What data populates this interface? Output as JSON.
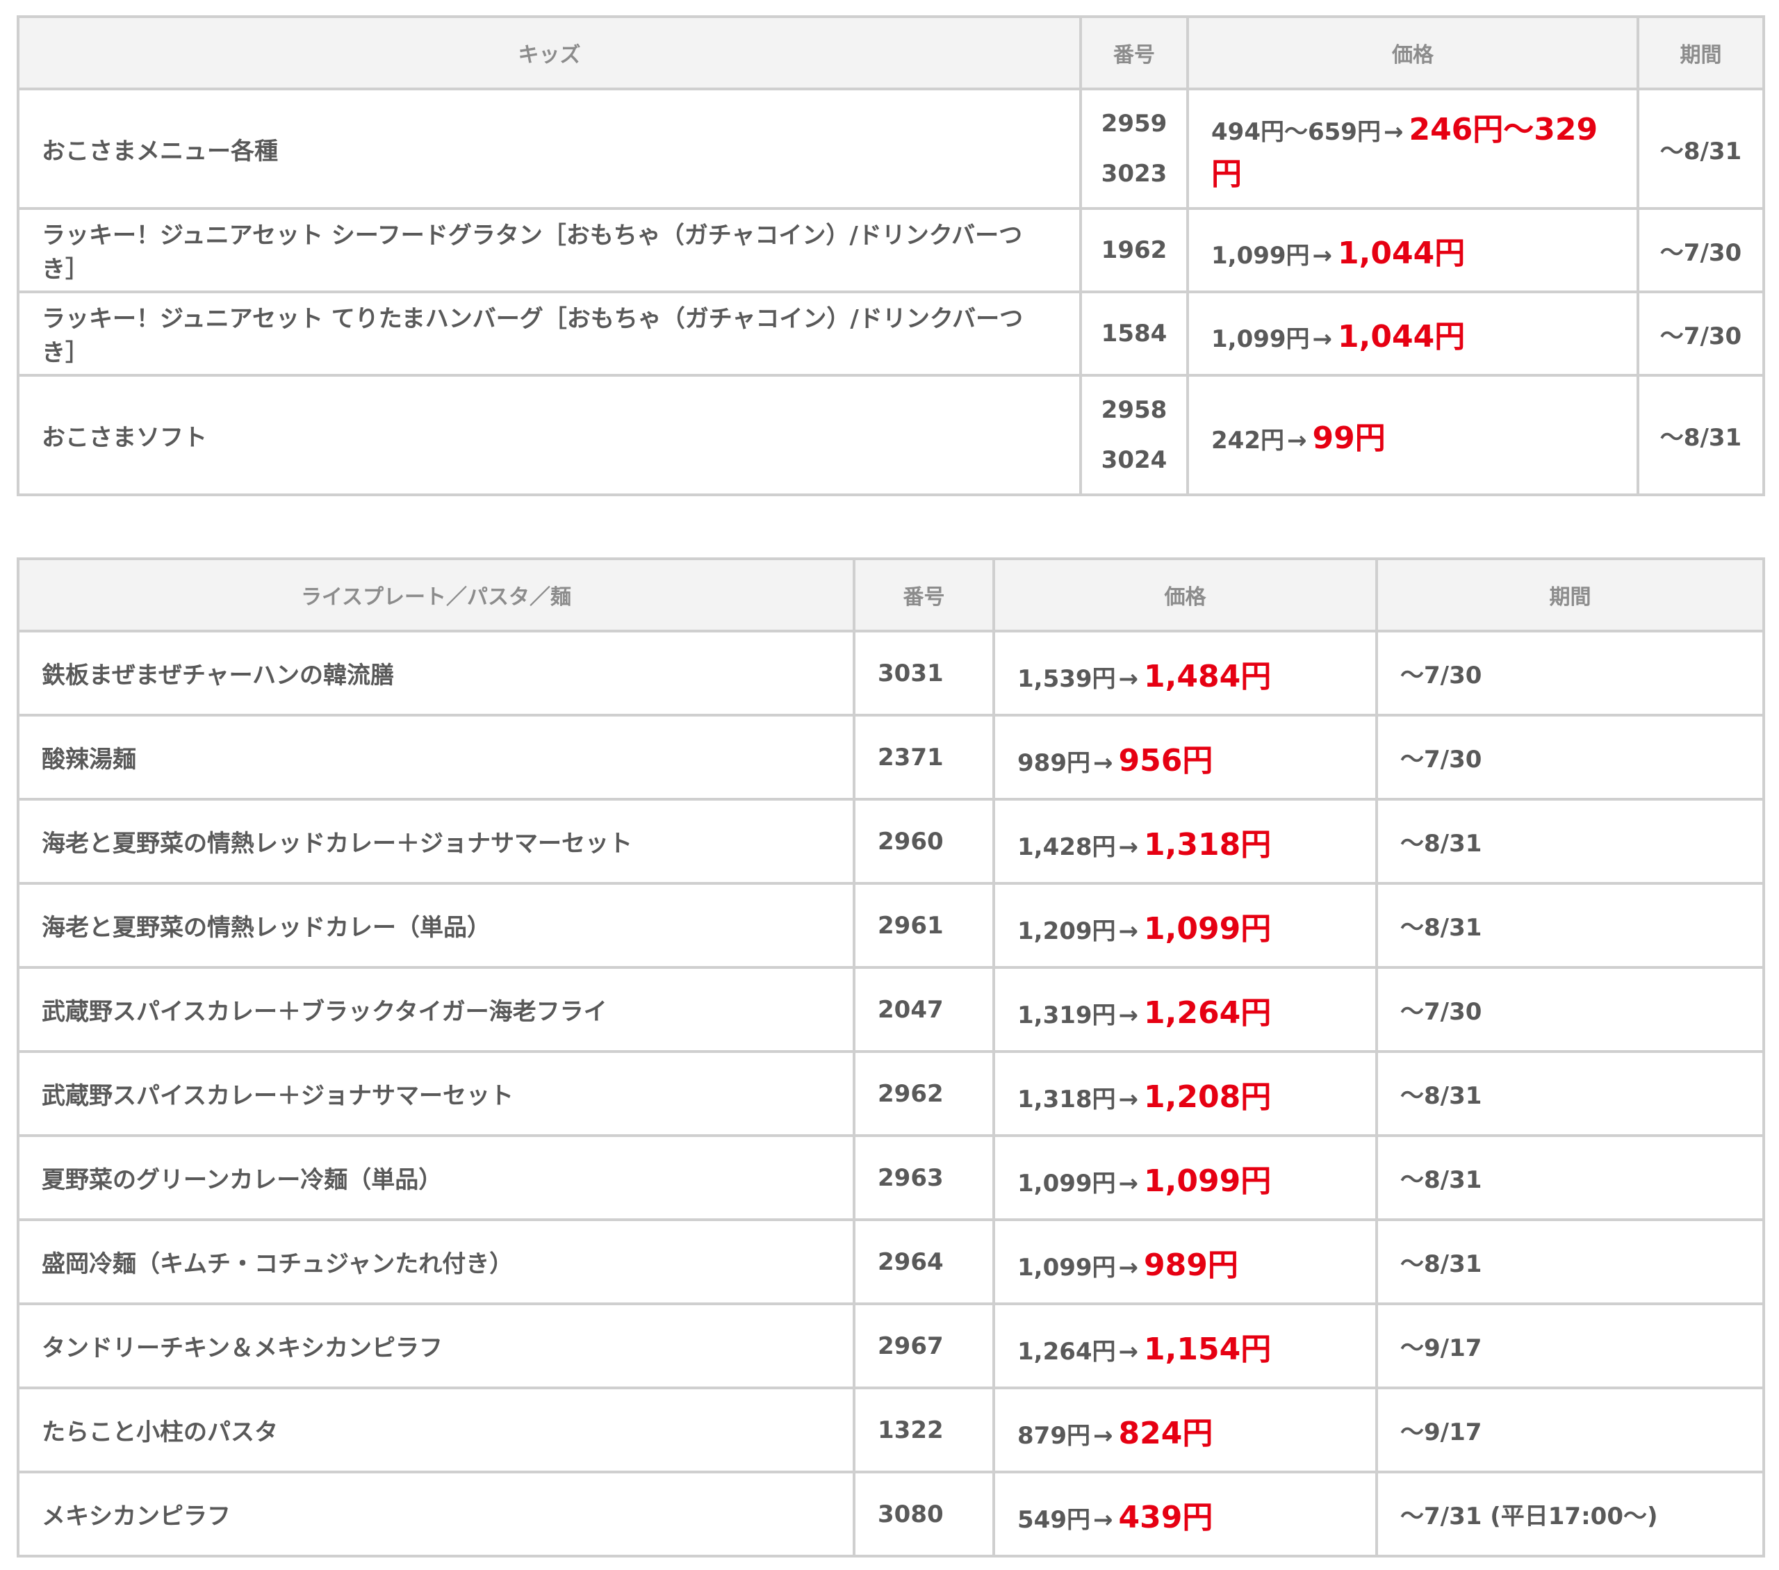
{
  "kids_table": {
    "headers": {
      "name": "キッズ",
      "number": "番号",
      "price": "価格",
      "period": "期間"
    },
    "rows": [
      {
        "name": "おこさまメニュー各種",
        "numbers": [
          "2959",
          "3023"
        ],
        "old_price": "494円～659円",
        "arrow": "→",
        "new_price": "246円～329円",
        "period": "～8/31"
      },
      {
        "name": "ラッキー！ジュニアセット シーフードグラタン［おもちゃ（ガチャコイン）/ドリンクバーつき］",
        "numbers": [
          "1962"
        ],
        "old_price": "1,099円",
        "arrow": "→",
        "new_price": "1,044円",
        "period": "～7/30"
      },
      {
        "name": "ラッキー！ジュニアセット てりたまハンバーグ［おもちゃ（ガチャコイン）/ドリンクバーつき］",
        "numbers": [
          "1584"
        ],
        "old_price": "1,099円",
        "arrow": "→",
        "new_price": "1,044円",
        "period": "～7/30"
      },
      {
        "name": "おこさまソフト",
        "numbers": [
          "2958",
          "3024"
        ],
        "old_price": "242円",
        "arrow": "→",
        "new_price": "99円",
        "period": "～8/31"
      }
    ]
  },
  "rice_table": {
    "headers": {
      "name": "ライスプレート／パスタ／麺",
      "number": "番号",
      "price": "価格",
      "period": "期間"
    },
    "rows": [
      {
        "name": "鉄板まぜまぜチャーハンの韓流膳",
        "numbers": [
          "3031"
        ],
        "old_price": "1,539円",
        "arrow": "→",
        "new_price": "1,484円",
        "period": "～7/30"
      },
      {
        "name": "酸辣湯麺",
        "numbers": [
          "2371"
        ],
        "old_price": "989円",
        "arrow": "→",
        "new_price": "956円",
        "period": "～7/30"
      },
      {
        "name": "海老と夏野菜の情熱レッドカレー＋ジョナサマーセット",
        "numbers": [
          "2960"
        ],
        "old_price": "1,428円",
        "arrow": "→",
        "new_price": "1,318円",
        "period": "～8/31"
      },
      {
        "name": "海老と夏野菜の情熱レッドカレー（単品）",
        "numbers": [
          "2961"
        ],
        "old_price": "1,209円",
        "arrow": "→",
        "new_price": "1,099円",
        "period": "～8/31"
      },
      {
        "name": "武蔵野スパイスカレー＋ブラックタイガー海老フライ",
        "numbers": [
          "2047"
        ],
        "old_price": "1,319円",
        "arrow": "→",
        "new_price": "1,264円",
        "period": "～7/30"
      },
      {
        "name": "武蔵野スパイスカレー＋ジョナサマーセット",
        "numbers": [
          "2962"
        ],
        "old_price": "1,318円",
        "arrow": "→",
        "new_price": "1,208円",
        "period": "～8/31"
      },
      {
        "name": "夏野菜のグリーンカレー冷麺（単品）",
        "numbers": [
          "2963"
        ],
        "old_price": "1,099円",
        "arrow": "→",
        "new_price": "1,099円",
        "period": "～8/31"
      },
      {
        "name": "盛岡冷麺（キムチ・コチュジャンたれ付き）",
        "numbers": [
          "2964"
        ],
        "old_price": "1,099円",
        "arrow": "→",
        "new_price": "989円",
        "period": "～8/31"
      },
      {
        "name": "タンドリーチキン＆メキシカンピラフ",
        "numbers": [
          "2967"
        ],
        "old_price": "1,264円",
        "arrow": "→",
        "new_price": "1,154円",
        "period": "～9/17"
      },
      {
        "name": "たらこと小柱のパスタ",
        "numbers": [
          "1322"
        ],
        "old_price": "879円",
        "arrow": "→",
        "new_price": "824円",
        "period": "～9/17"
      },
      {
        "name": "メキシカンピラフ",
        "numbers": [
          "3080"
        ],
        "old_price": "549円",
        "arrow": "→",
        "new_price": "439円",
        "period": "～7/31 (平日17:00～)"
      }
    ]
  },
  "colors": {
    "sale_price": "#e60012",
    "header_bg": "#f3f3f3",
    "border": "#cfcfcf",
    "text": "#595959"
  }
}
